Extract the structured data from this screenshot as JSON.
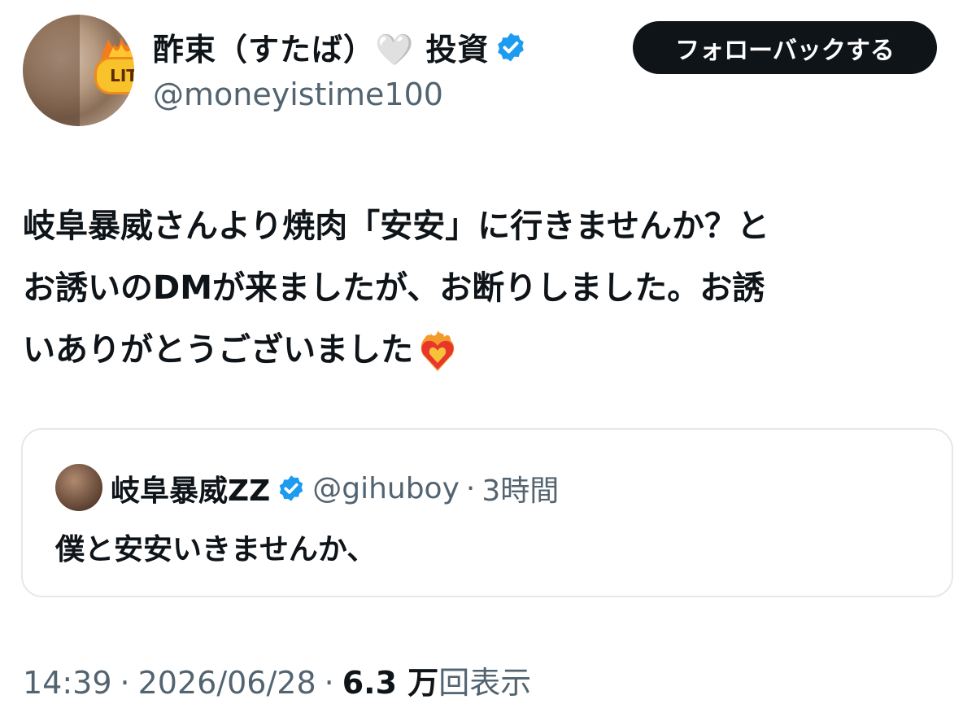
{
  "author": {
    "display_name": "酢束（すたば）🤍 投資",
    "handle": "@moneyistime100",
    "avatar_badge": "LIT",
    "verified_icon": "verified-badge-icon",
    "accent_color": "#1d9bf0"
  },
  "follow_button": {
    "label": "フォローバックする"
  },
  "tweet": {
    "text": "岐阜暴威さんより焼肉「安安」に行きませんか？と\nお誘いのDMが来ましたが、お断りしました。お誘\nいありがとうございました",
    "emoji_icon": "heart-on-fire-icon"
  },
  "quoted_tweet": {
    "display_name": "岐阜暴威ZZ",
    "handle": "@gihuboy",
    "separator": "·",
    "time": "3時間",
    "text": "僕と安安いきませんか、"
  },
  "meta": {
    "time": "14:39",
    "dot1": "·",
    "date": "2026/06/28",
    "dot2": "·",
    "views_count": "6.3 万",
    "views_label": "回表示"
  }
}
